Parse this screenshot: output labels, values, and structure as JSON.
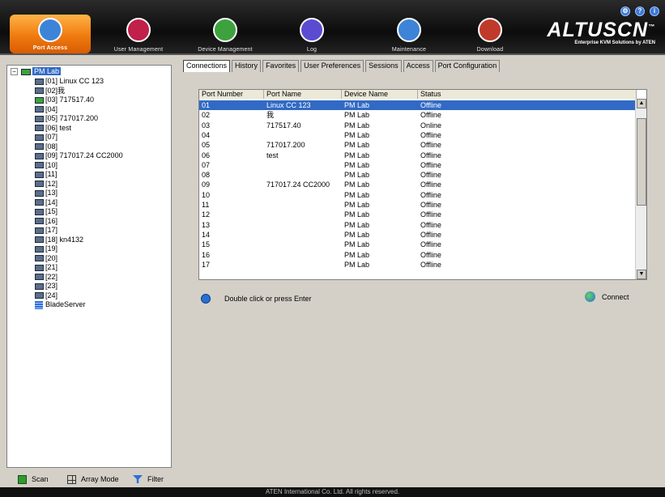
{
  "brand": {
    "name": "ALTUSCN",
    "tm": "™",
    "tagline": "Enterprise KVM Solutions by ATEN"
  },
  "window_buttons": [
    "⚙",
    "?",
    "i"
  ],
  "nav": [
    {
      "label": "Port Access",
      "icon": "monitor-icon",
      "active": true
    },
    {
      "label": "User Management",
      "icon": "users-icon",
      "active": false
    },
    {
      "label": "Device Management",
      "icon": "device-icon",
      "active": false
    },
    {
      "label": "Log",
      "icon": "log-icon",
      "active": false
    },
    {
      "label": "Maintenance",
      "icon": "wrench-icon",
      "active": false
    },
    {
      "label": "Download",
      "icon": "download-icon",
      "active": false
    }
  ],
  "tree": {
    "root": "PM Lab",
    "ports": [
      {
        "label": "[01] Linux CC 123",
        "online": false
      },
      {
        "label": "[02]我",
        "online": false
      },
      {
        "label": "[03] 717517.40",
        "online": true
      },
      {
        "label": "[04]",
        "online": false
      },
      {
        "label": "[05] 717017.200",
        "online": false
      },
      {
        "label": "[06] test",
        "online": false
      },
      {
        "label": "[07]",
        "online": false
      },
      {
        "label": "[08]",
        "online": false
      },
      {
        "label": "[09] 717017.24 CC2000",
        "online": false
      },
      {
        "label": "[10]",
        "online": false
      },
      {
        "label": "[11]",
        "online": false
      },
      {
        "label": "[12]",
        "online": false
      },
      {
        "label": "[13]",
        "online": false
      },
      {
        "label": "[14]",
        "online": false
      },
      {
        "label": "[15]",
        "online": false
      },
      {
        "label": "[16]",
        "online": false
      },
      {
        "label": "[17]",
        "online": false
      },
      {
        "label": "[18] kn4132",
        "online": false
      },
      {
        "label": "[19]",
        "online": false
      },
      {
        "label": "[20]",
        "online": false
      },
      {
        "label": "[21]",
        "online": false
      },
      {
        "label": "[22]",
        "online": false
      },
      {
        "label": "[23]",
        "online": false
      },
      {
        "label": "[24]",
        "online": false
      }
    ],
    "blade": "BladeServer"
  },
  "bottom": {
    "scan": "Scan",
    "array_mode": "Array Mode",
    "filter": "Filter"
  },
  "tabs": [
    "Connections",
    "History",
    "Favorites",
    "User Preferences",
    "Sessions",
    "Access",
    "Port Configuration"
  ],
  "table": {
    "headers": [
      "Port Number",
      "Port Name",
      "Device Name",
      "Status"
    ],
    "rows": [
      [
        "01",
        "Linux CC 123",
        "PM Lab",
        "Offline"
      ],
      [
        "02",
        "我",
        "PM Lab",
        "Offline"
      ],
      [
        "03",
        "717517.40",
        "PM Lab",
        "Online"
      ],
      [
        "04",
        "",
        "PM Lab",
        "Offline"
      ],
      [
        "05",
        "717017.200",
        "PM Lab",
        "Offline"
      ],
      [
        "06",
        "test",
        "PM Lab",
        "Offline"
      ],
      [
        "07",
        "",
        "PM Lab",
        "Offline"
      ],
      [
        "08",
        "",
        "PM Lab",
        "Offline"
      ],
      [
        "09",
        "717017.24 CC2000",
        "PM Lab",
        "Offline"
      ],
      [
        "10",
        "",
        "PM Lab",
        "Offline"
      ],
      [
        "11",
        "",
        "PM Lab",
        "Offline"
      ],
      [
        "12",
        "",
        "PM Lab",
        "Offline"
      ],
      [
        "13",
        "",
        "PM Lab",
        "Offline"
      ],
      [
        "14",
        "",
        "PM Lab",
        "Offline"
      ],
      [
        "15",
        "",
        "PM Lab",
        "Offline"
      ],
      [
        "16",
        "",
        "PM Lab",
        "Offline"
      ],
      [
        "17",
        "",
        "PM Lab",
        "Offline"
      ]
    ],
    "selected_row": 0
  },
  "hint": "Double click or press Enter",
  "connect": "Connect",
  "footer": "ATEN International Co. Ltd. All rights reserved.",
  "colors": {
    "accent": "#f07b10",
    "selection": "#316ac5",
    "online": "#3da23d"
  }
}
